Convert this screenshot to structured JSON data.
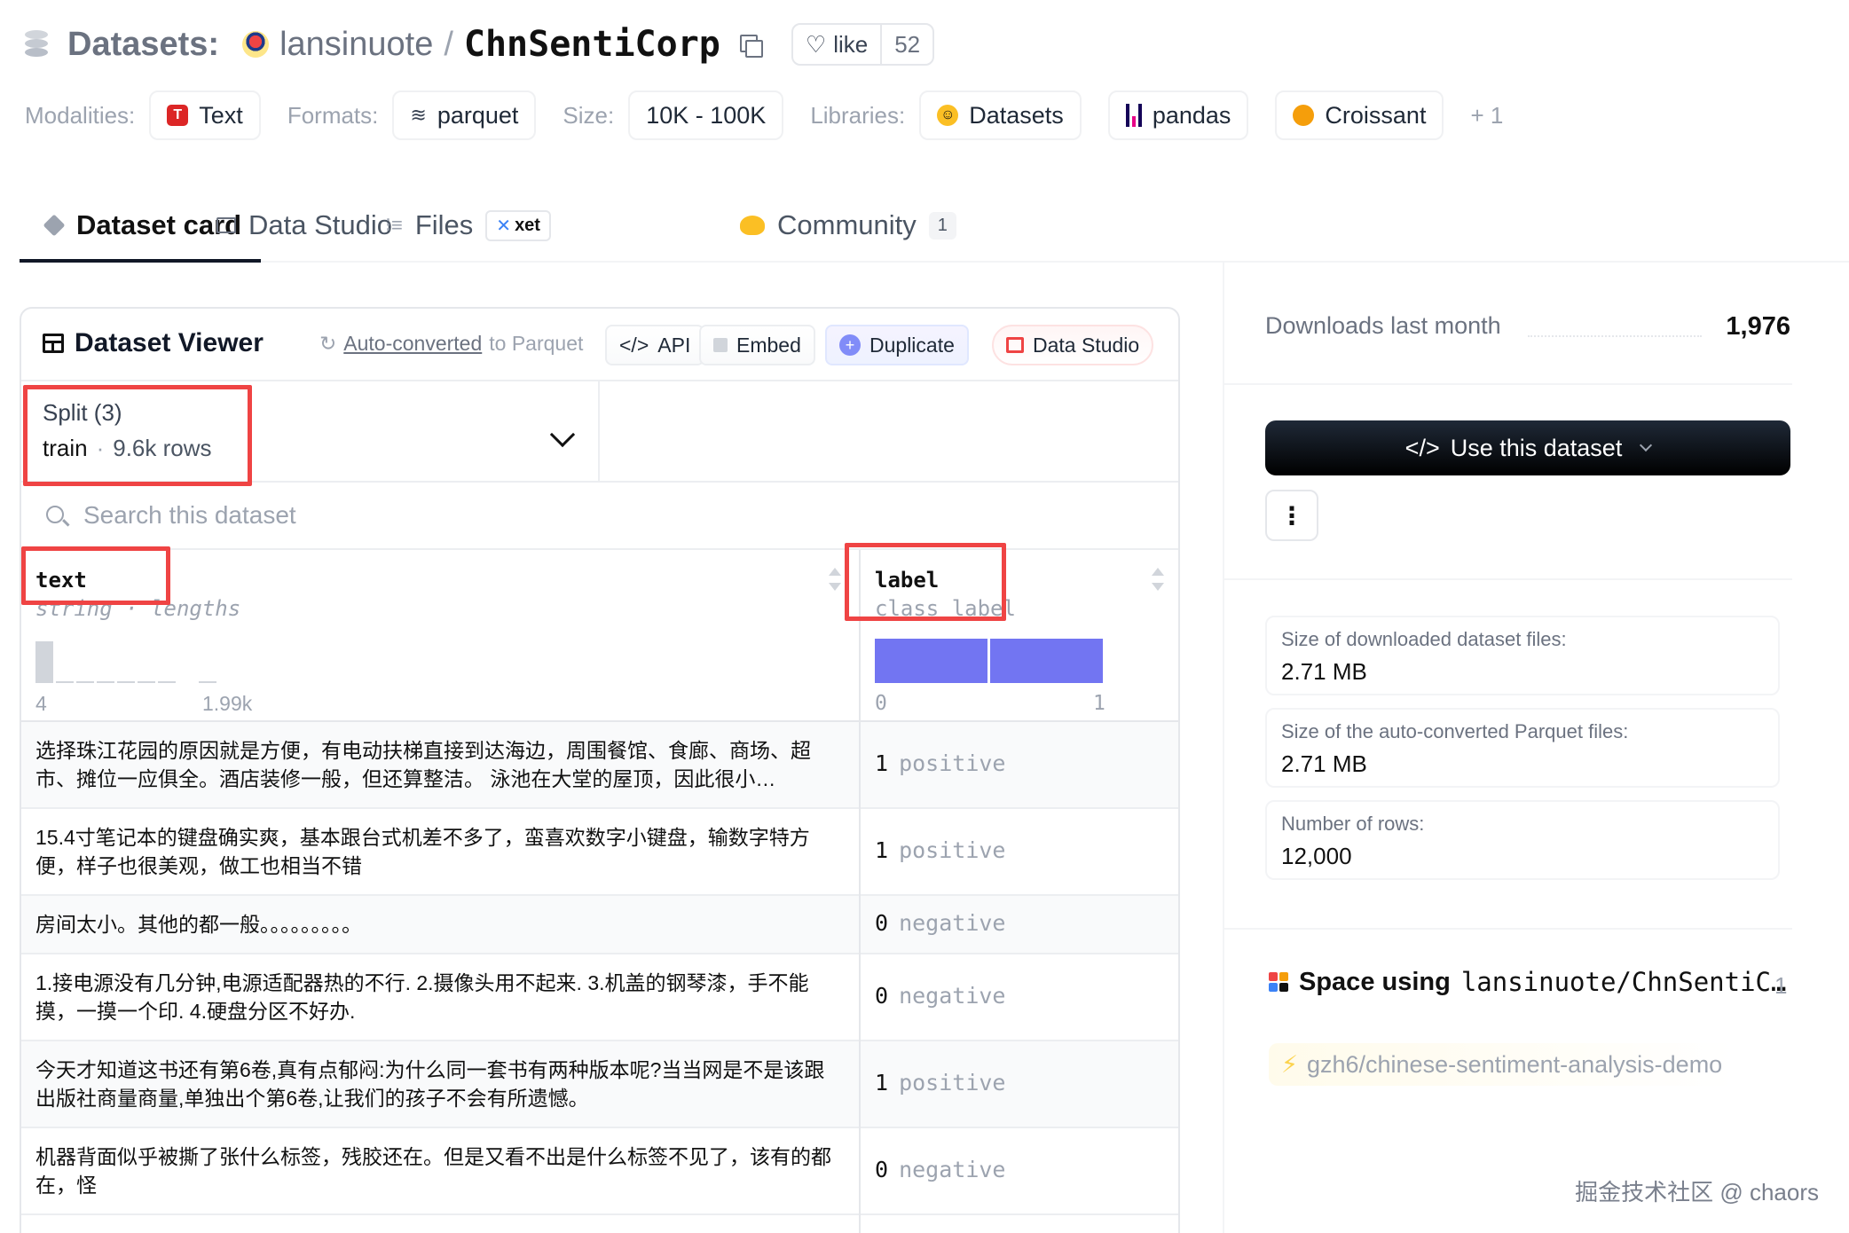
{
  "header": {
    "section_label": "Datasets:",
    "owner": "lansinuote",
    "slash": "/",
    "name": "ChnSentiCorp",
    "like_label": "like",
    "like_count": "52"
  },
  "meta": {
    "modalities_label": "Modalities:",
    "modality": "Text",
    "formats_label": "Formats:",
    "format": "parquet",
    "size_label": "Size:",
    "size": "10K - 100K",
    "libraries_label": "Libraries:",
    "libraries": [
      "Datasets",
      "pandas",
      "Croissant"
    ],
    "more": "+ 1"
  },
  "tabs": {
    "dataset_card": "Dataset card",
    "data_studio": "Data Studio",
    "files": "Files",
    "xet": "xet",
    "community": "Community",
    "community_count": "1"
  },
  "viewer": {
    "title": "Dataset Viewer",
    "auto_converted": "Auto-converted",
    "to_parquet": "to Parquet",
    "buttons": {
      "api": "API",
      "embed": "Embed",
      "duplicate": "Duplicate",
      "data_studio": "Data Studio"
    },
    "split": {
      "label": "Split (3)",
      "name": "train",
      "dot": "·",
      "rows": "9.6k rows"
    },
    "search_placeholder": "Search this dataset",
    "columns": [
      {
        "name": "text",
        "type": "string · lengths",
        "axis_min": "4",
        "axis_max": "1.99k",
        "hist": [
          0.95,
          0.05,
          0.04,
          0.04,
          0.03,
          0.03,
          0.03,
          0,
          0.02
        ]
      },
      {
        "name": "label",
        "type": "class label",
        "axis_min": "0",
        "axis_max": "1",
        "classes": [
          0.5,
          0.5
        ]
      }
    ],
    "rows": [
      {
        "text": "选择珠江花园的原因就是方便，有电动扶梯直接到达海边，周围餐馆、食廊、商场、超市、摊位一应俱全。酒店装修一般，但还算整洁。 泳池在大堂的屋顶，因此很小…",
        "label_id": "1",
        "label_name": "positive"
      },
      {
        "text": "15.4寸笔记本的键盘确实爽，基本跟台式机差不多了，蛮喜欢数字小键盘，输数字特方便，样子也很美观，做工也相当不错",
        "label_id": "1",
        "label_name": "positive"
      },
      {
        "text": "房间太小。其他的都一般。。。。。。。。。",
        "label_id": "0",
        "label_name": "negative"
      },
      {
        "text": "1.接电源没有几分钟,电源适配器热的不行. 2.摄像头用不起来. 3.机盖的钢琴漆，手不能摸，一摸一个印. 4.硬盘分区不好办.",
        "label_id": "0",
        "label_name": "negative"
      },
      {
        "text": "今天才知道这书还有第6卷,真有点郁闷:为什么同一套书有两种版本呢?当当网是不是该跟出版社商量商量,单独出个第6卷,让我们的孩子不会有所遗憾。",
        "label_id": "1",
        "label_name": "positive"
      },
      {
        "text": "机器背面似乎被撕了张什么标签，残胶还在。但是又看不出是什么标签不见了，该有的都在，怪",
        "label_id": "0",
        "label_name": "negative"
      }
    ]
  },
  "sidebar": {
    "downloads_label": "Downloads last month",
    "downloads_value": "1,976",
    "use_dataset": "Use this dataset",
    "more": "⋮",
    "stats": [
      {
        "key": "Size of downloaded dataset files:",
        "value": "2.71 MB"
      },
      {
        "key": "Size of the auto-converted Parquet files:",
        "value": "2.71 MB"
      },
      {
        "key": "Number of rows:",
        "value": "12,000"
      }
    ],
    "space_label": "Space using",
    "space_repo": "lansinuote/ChnSentiC…",
    "space_count": "1",
    "space_item": "gzh6/chinese-sentiment-analysis-demo"
  },
  "watermark": "掘金技术社区 @ chaors",
  "colors": {
    "accent_class_bar": "#6366f1",
    "highlight": "#ef4444"
  }
}
